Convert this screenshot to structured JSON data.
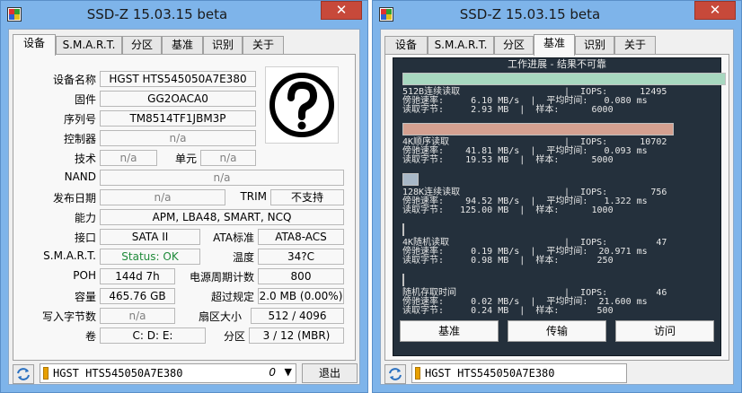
{
  "left": {
    "title": "SSD-Z 15.03.15 beta",
    "close": "✕",
    "tabs": [
      "设备",
      "S.M.A.R.T.",
      "分区",
      "基准",
      "识别",
      "关于"
    ],
    "device": {
      "name_label": "设备名称",
      "name": "HGST HTS545050A7E380",
      "firmware_label": "固件",
      "firmware": "GG2OACA0",
      "serial_label": "序列号",
      "serial": "TM8514TF1JBM3P",
      "controller_label": "控制器",
      "controller": "n/a",
      "tech_label": "技术",
      "tech": "n/a",
      "cell_label": "单元",
      "cell": "n/a",
      "nand_label": "NAND",
      "nand": "n/a",
      "release_label": "发布日期",
      "release": "n/a",
      "trim_label": "TRIM",
      "trim": "不支持",
      "cap_label": "能力",
      "capability": "APM, LBA48, SMART, NCQ",
      "iface_label": "接口",
      "interface": "SATA II",
      "ata_label": "ATA标准",
      "ata": "ATA8-ACS",
      "smart_label": "S.M.A.R.T.",
      "smart": "Status: OK",
      "temp_label": "温度",
      "temp": "34?C",
      "poh_label": "POH",
      "poh": "144d 7h",
      "cycles_label": "电源周期计数",
      "cycles": "800",
      "capacity_label": "容量",
      "capacity": "465.76 GB",
      "overprov_label": "超过规定",
      "overprov": "2.0 MB (0.00%)",
      "written_label": "写入字节数",
      "written": "n/a",
      "sector_label": "扇区大小",
      "sector": "512 / 4096",
      "volume_label": "卷",
      "volume": "C:  D:  E:",
      "partition_label": "分区",
      "partition": "3 / 12 (MBR)"
    },
    "drive_combo": "HGST HTS545050A7E380",
    "drive_index": "0",
    "exit_label": "退出"
  },
  "right": {
    "title": "SSD-Z 15.03.15 beta",
    "close": "✕",
    "tabs": [
      "设备",
      "S.M.A.R.T.",
      "分区",
      "基准",
      "识别",
      "关于"
    ],
    "bench_header": "工作进展 - 结果不可靠",
    "tests": [
      {
        "l1": "512B连续读取",
        "l2": "傍驰速率:     6.10 MB/s  |  平均时间:   0.080 ms",
        "l3": "读取字节:     2.93 MB  |  样本:      6000",
        "iops": "IOPS:      12495",
        "fill": 1.0,
        "color": "#a8d8c0"
      },
      {
        "l1": "4K顺序读取",
        "l2": "傍驰速率:    41.81 MB/s  |  平均时间:   0.093 ms",
        "l3": "读取字节:    19.53 MB  |  样本:      5000",
        "iops": "IOPS:      10702",
        "fill": 0.84,
        "color": "#d4a090"
      },
      {
        "l1": "128K连续读取",
        "l2": "傍驰速率:    94.52 MB/s  |  平均时间:   1.322 ms",
        "l3": "读取字节:   125.00 MB  |  样本:      1000",
        "iops": "IOPS:        756",
        "fill": 0.05,
        "color": "#a8b8c8"
      },
      {
        "l1": "4K随机读取",
        "l2": "傍驰速率:     0.19 MB/s  |  平均时间:  20.971 ms",
        "l3": "读取字节:     0.98 MB  |  样本:       250",
        "iops": "IOPS:         47",
        "fill": 0.005,
        "color": "#6a9a60"
      },
      {
        "l1": "随机存取时间",
        "l2": "傍驰速率:     0.02 MB/s  |  平均时间:  21.600 ms",
        "l3": "读取字节:     0.24 MB  |  样本:       500",
        "iops": "IOPS:         46",
        "fill": 0.005,
        "color": "#6a9a60"
      }
    ],
    "btn_bench": "基准",
    "btn_transfer": "传输",
    "btn_access": "访问",
    "drive_combo": "HGST HTS545050A7E380"
  }
}
